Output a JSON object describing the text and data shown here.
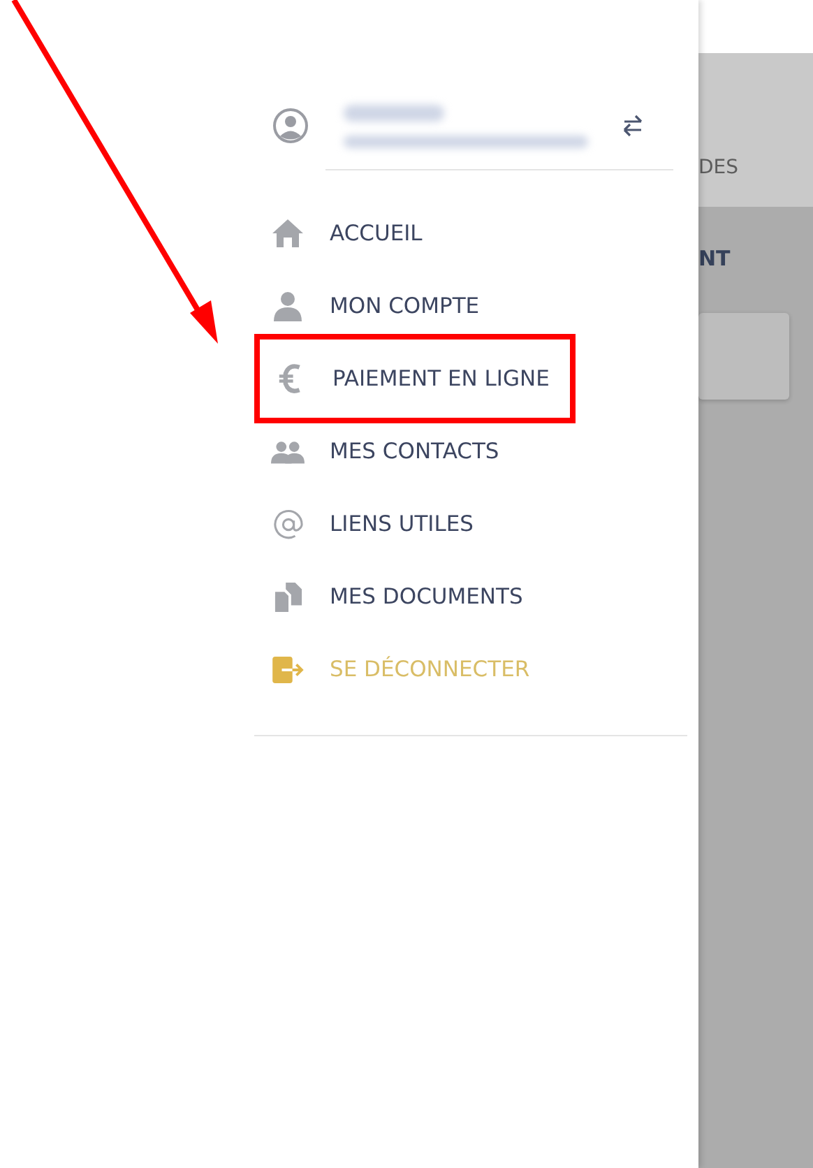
{
  "background": {
    "tab_fragment": "DES",
    "heading_fragment": "NT"
  },
  "menu": [
    {
      "label": "ACCUEIL",
      "kind": "link",
      "highlighted": false
    },
    {
      "label": "MON COMPTE",
      "kind": "link",
      "highlighted": false
    },
    {
      "label": "PAIEMENT EN LIGNE",
      "kind": "link",
      "highlighted": true
    },
    {
      "label": "MES CONTACTS",
      "kind": "link",
      "highlighted": false
    },
    {
      "label": "LIENS UTILES",
      "kind": "link",
      "highlighted": false
    },
    {
      "label": "MES DOCUMENTS",
      "kind": "link",
      "highlighted": false
    },
    {
      "label": "SE DÉCONNECTER",
      "kind": "logout",
      "highlighted": false
    }
  ]
}
